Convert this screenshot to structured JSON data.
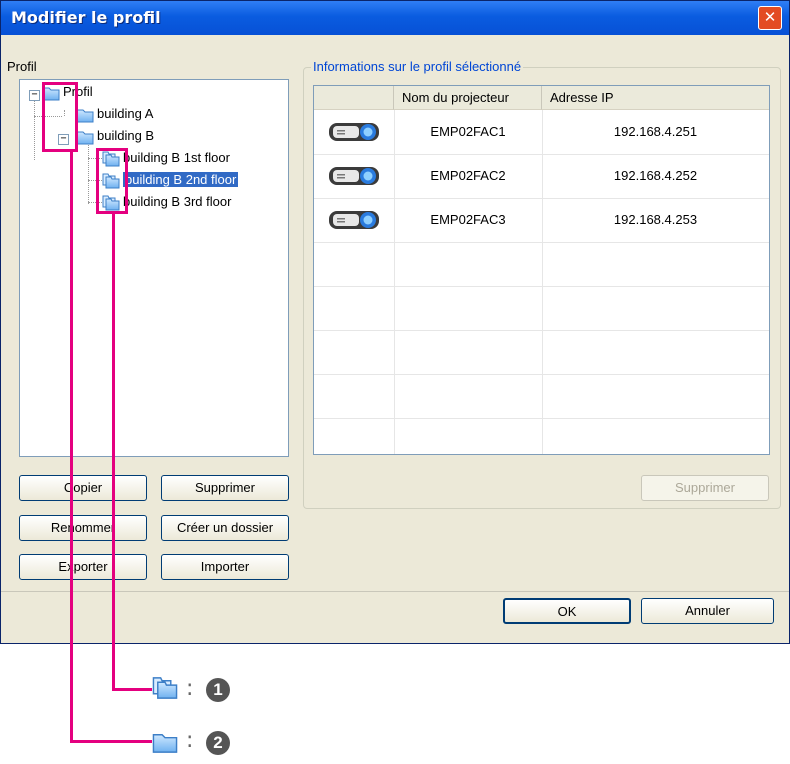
{
  "dialog": {
    "title": "Modifier le profil",
    "close_label": "✕"
  },
  "left": {
    "label": "Profil",
    "tree": [
      {
        "label": "Profil",
        "type": "folder",
        "selected": false
      },
      {
        "label": "building A",
        "type": "folder",
        "selected": false
      },
      {
        "label": "building B",
        "type": "folder",
        "selected": false
      },
      {
        "label": "building B 1st floor",
        "type": "profile",
        "selected": false
      },
      {
        "label": "building B 2nd floor",
        "type": "profile",
        "selected": true
      },
      {
        "label": "building B 3rd floor",
        "type": "profile",
        "selected": false
      }
    ],
    "buttons": {
      "copy": "Copier",
      "delete": "Supprimer",
      "rename": "Renommer",
      "new_folder": "Créer un dossier",
      "export": "Exporter",
      "import": "Importer"
    }
  },
  "right": {
    "group_label": "Informations sur le profil sélectionné",
    "columns": [
      "Nom du projecteur",
      "Adresse IP"
    ],
    "rows": [
      {
        "name": "EMP02FAC1",
        "ip": "192.168.4.251"
      },
      {
        "name": "EMP02FAC2",
        "ip": "192.168.4.252"
      },
      {
        "name": "EMP02FAC3",
        "ip": "192.168.4.253"
      }
    ],
    "delete_button": "Supprimer"
  },
  "footer": {
    "ok": "OK",
    "cancel": "Annuler"
  },
  "legend": [
    {
      "icon": "profile-folder-icon",
      "separator": ":",
      "number": "1"
    },
    {
      "icon": "group-folder-icon",
      "separator": ":",
      "number": "2"
    }
  ],
  "colors": {
    "callout": "#e4007f",
    "selection": "#316ac5",
    "titlebar": "#0a5ce0"
  }
}
